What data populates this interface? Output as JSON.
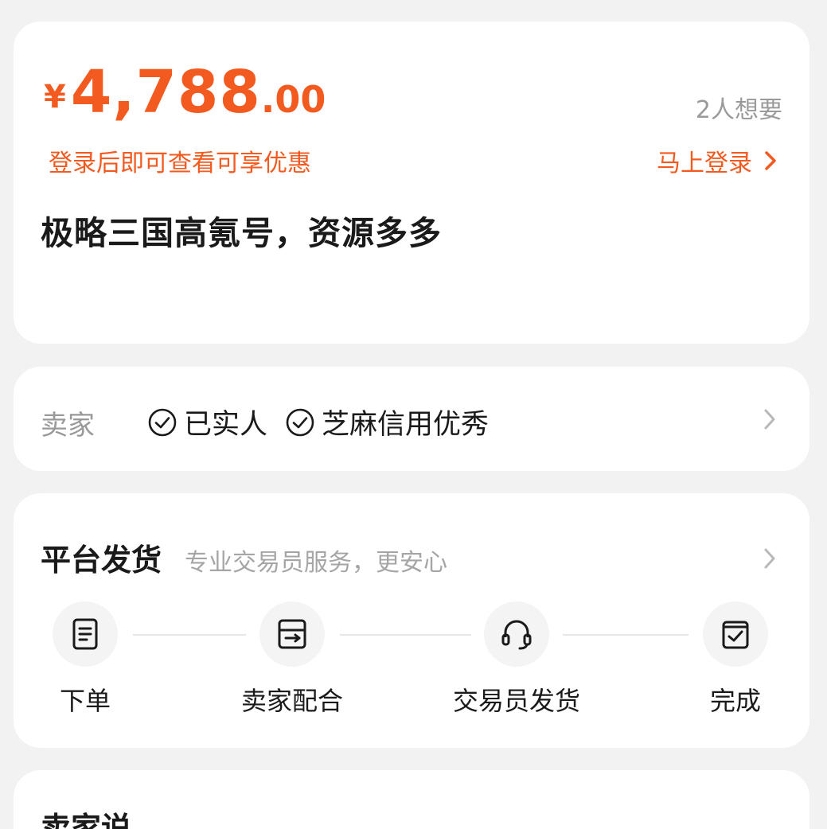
{
  "price_card": {
    "currency": "¥",
    "price_integer": "4,788",
    "price_decimal": ".00",
    "want_count": "2人想要",
    "promo_text": "登录后即可查看可享优惠",
    "login_label": "马上登录",
    "product_title": "极略三国高氪号，资源多多"
  },
  "seller_card": {
    "label": "卖家",
    "badges": [
      "已实人",
      "芝麻信用优秀"
    ]
  },
  "delivery_card": {
    "title": "平台发货",
    "subtitle": "专业交易员服务，更安心",
    "steps": [
      "下单",
      "卖家配合",
      "交易员发货",
      "完成"
    ]
  },
  "says_card": {
    "title": "卖家说"
  },
  "colors": {
    "accent": "#f25a1f",
    "background": "#f2f2f2"
  },
  "icons": {
    "login_arrow": "chevron-right-icon",
    "badge": "check-circle-icon",
    "steps": [
      "order-document-icon",
      "seller-box-icon",
      "headset-icon",
      "complete-bag-icon"
    ]
  }
}
